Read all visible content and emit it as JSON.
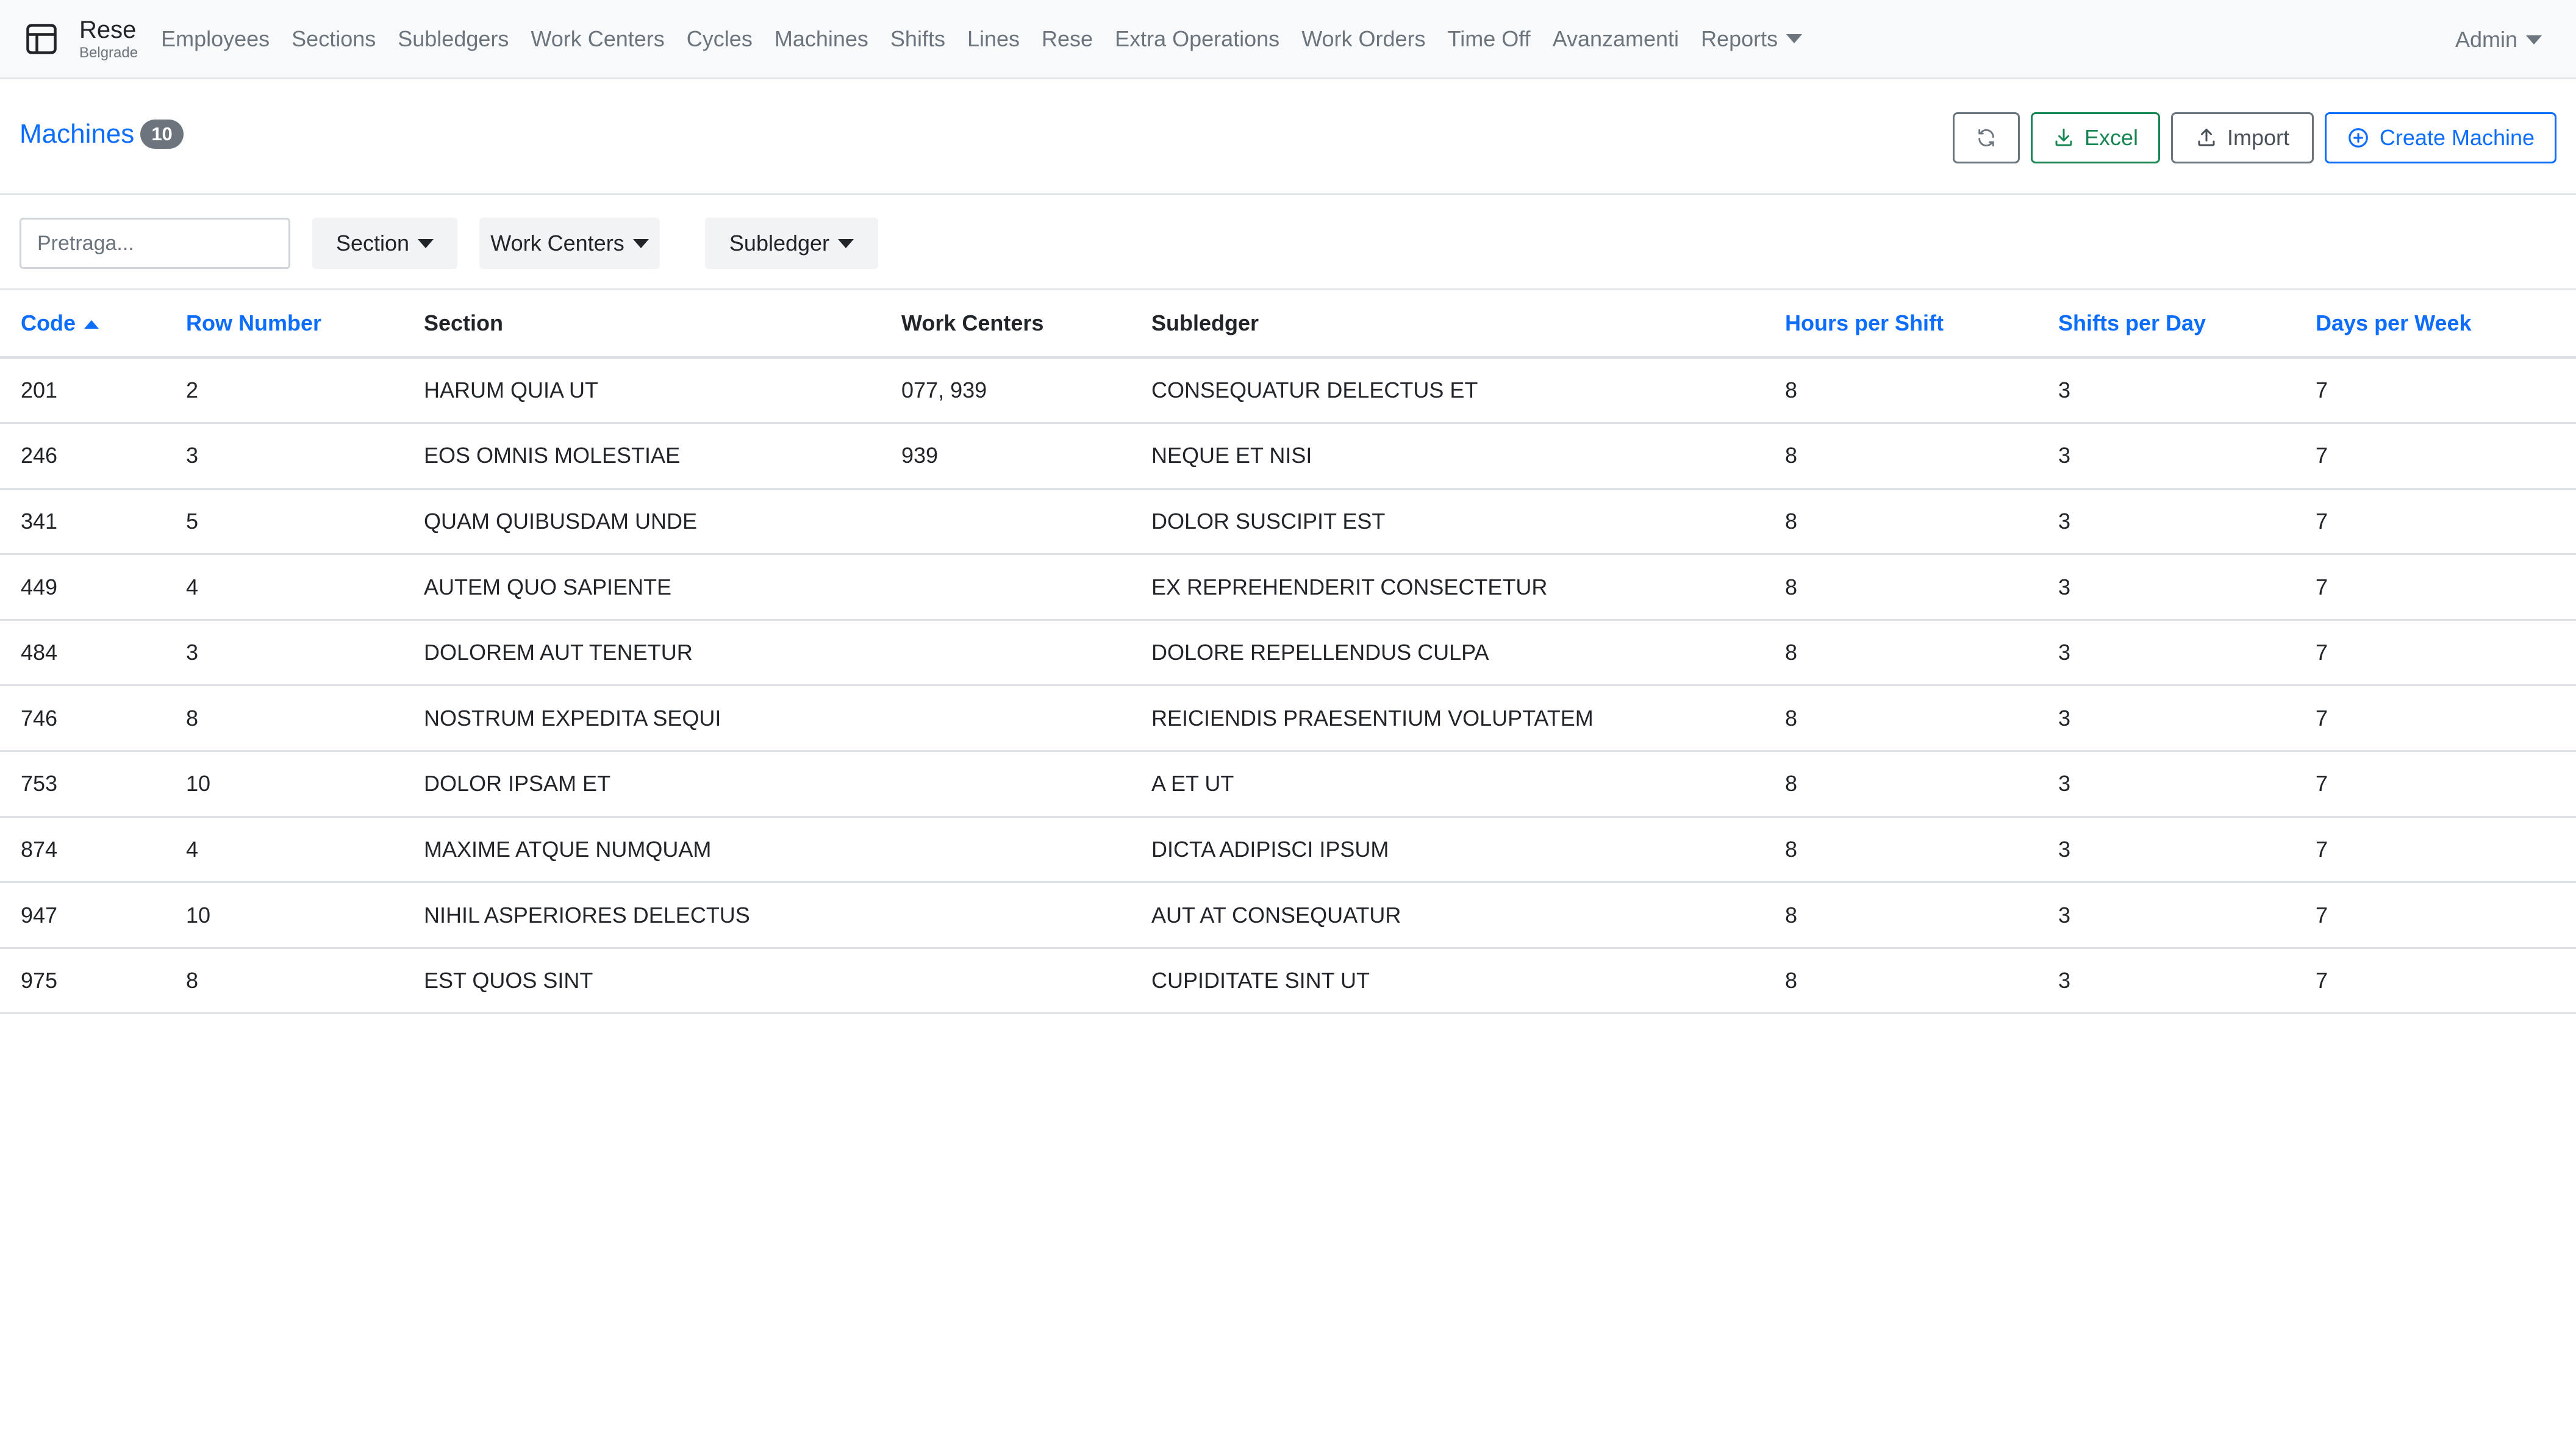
{
  "app": {
    "brand_name": "Rese",
    "brand_sub": "Belgrade",
    "nav": [
      {
        "label": "Employees"
      },
      {
        "label": "Sections"
      },
      {
        "label": "Subledgers"
      },
      {
        "label": "Work Centers"
      },
      {
        "label": "Cycles"
      },
      {
        "label": "Machines"
      },
      {
        "label": "Shifts"
      },
      {
        "label": "Lines"
      },
      {
        "label": "Rese"
      },
      {
        "label": "Extra Operations"
      },
      {
        "label": "Work Orders"
      },
      {
        "label": "Time Off"
      },
      {
        "label": "Avanzamenti"
      },
      {
        "label": "Reports"
      }
    ],
    "user": "Admin"
  },
  "header": {
    "title": "Machines",
    "count": "10",
    "buttons": {
      "refresh_icon": "refresh-icon",
      "excel": "Excel",
      "import": "Import",
      "create": "Create Machine"
    }
  },
  "filters": {
    "search_placeholder": "Pretraga...",
    "section": "Section",
    "work_centers": "Work Centers",
    "subledger": "Subledger"
  },
  "table": {
    "columns": [
      {
        "label": "Code"
      },
      {
        "label": "Row Number"
      },
      {
        "label": "Section"
      },
      {
        "label": "Work Centers"
      },
      {
        "label": "Subledger"
      },
      {
        "label": "Hours per Shift"
      },
      {
        "label": "Shifts per Day"
      },
      {
        "label": "Days per Week"
      }
    ],
    "rows": [
      {
        "code": "201",
        "row_number": "2",
        "section": "HARUM QUIA UT",
        "work_centers": "077, 939",
        "subledger": "CONSEQUATUR DELECTUS ET",
        "hours": "8",
        "shifts": "3",
        "days": "7"
      },
      {
        "code": "246",
        "row_number": "3",
        "section": "EOS OMNIS MOLESTIAE",
        "work_centers": "939",
        "subledger": "NEQUE ET NISI",
        "hours": "8",
        "shifts": "3",
        "days": "7"
      },
      {
        "code": "341",
        "row_number": "5",
        "section": "QUAM QUIBUSDAM UNDE",
        "work_centers": "",
        "subledger": "DOLOR SUSCIPIT EST",
        "hours": "8",
        "shifts": "3",
        "days": "7"
      },
      {
        "code": "449",
        "row_number": "4",
        "section": "AUTEM QUO SAPIENTE",
        "work_centers": "",
        "subledger": "EX REPREHENDERIT CONSECTETUR",
        "hours": "8",
        "shifts": "3",
        "days": "7"
      },
      {
        "code": "484",
        "row_number": "3",
        "section": "DOLOREM AUT TENETUR",
        "work_centers": "",
        "subledger": "DOLORE REPELLENDUS CULPA",
        "hours": "8",
        "shifts": "3",
        "days": "7"
      },
      {
        "code": "746",
        "row_number": "8",
        "section": "NOSTRUM EXPEDITA SEQUI",
        "work_centers": "",
        "subledger": "REICIENDIS PRAESENTIUM VOLUPTATEM",
        "hours": "8",
        "shifts": "3",
        "days": "7"
      },
      {
        "code": "753",
        "row_number": "10",
        "section": "DOLOR IPSAM ET",
        "work_centers": "",
        "subledger": "A ET UT",
        "hours": "8",
        "shifts": "3",
        "days": "7"
      },
      {
        "code": "874",
        "row_number": "4",
        "section": "MAXIME ATQUE NUMQUAM",
        "work_centers": "",
        "subledger": "DICTA ADIPISCI IPSUM",
        "hours": "8",
        "shifts": "3",
        "days": "7"
      },
      {
        "code": "947",
        "row_number": "10",
        "section": "NIHIL ASPERIORES DELECTUS",
        "work_centers": "",
        "subledger": "AUT AT CONSEQUATUR",
        "hours": "8",
        "shifts": "3",
        "days": "7"
      },
      {
        "code": "975",
        "row_number": "8",
        "section": "EST QUOS SINT",
        "work_centers": "",
        "subledger": "CUPIDITATE SINT UT",
        "hours": "8",
        "shifts": "3",
        "days": "7"
      }
    ]
  },
  "colors": {
    "primary": "#0d6efd",
    "success": "#198754",
    "secondary": "#6c757d"
  }
}
